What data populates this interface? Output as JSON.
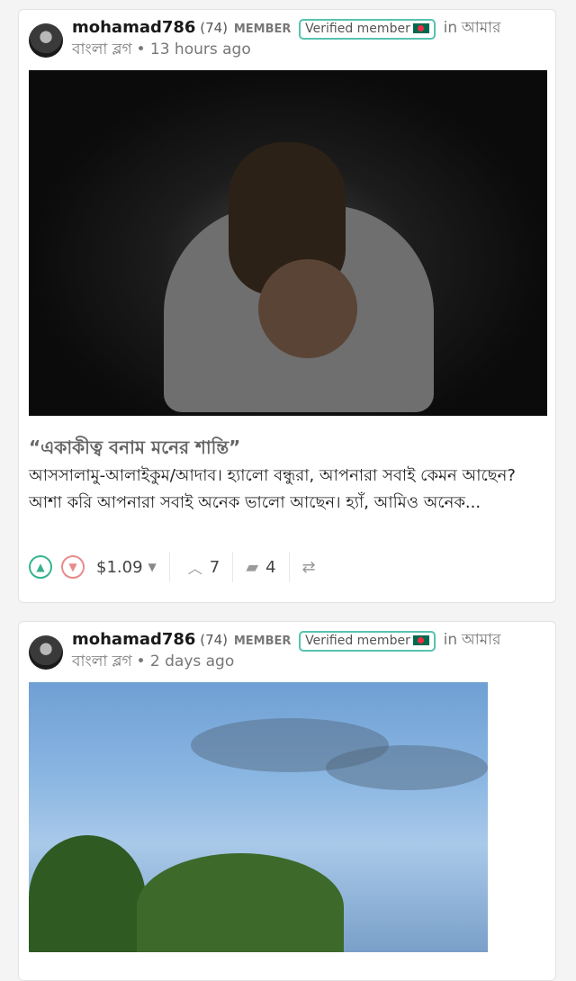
{
  "posts": [
    {
      "author": "mohamad786",
      "reputation": "(74)",
      "role": "MEMBER",
      "badge": "Verified member",
      "in_word": "in",
      "community": "আমার বাংলা ব্লগ",
      "time": "13 hours ago",
      "title": "“একাকীত্ব বনাম মনের শান্তি”",
      "excerpt": "আসসালামু-আলাইকুম/আদাব। হ্যালো বন্ধুরা, আপনারা সবাই কেমন আছেন? আশা করি আপনারা সবাই অনেক ভালো আছেন। হ্যাঁ, আমিও অনেক...",
      "payout": "$1.09",
      "votes": "7",
      "comments": "4"
    },
    {
      "author": "mohamad786",
      "reputation": "(74)",
      "role": "MEMBER",
      "badge": "Verified member",
      "in_word": "in",
      "community": "আমার বাংলা ব্লগ",
      "time": "2 days ago"
    }
  ],
  "icons": {
    "upvote": "chevron-up-circle-icon",
    "downvote": "chevron-down-circle-icon",
    "payout_caret": "caret-down-icon",
    "votes": "chevron-up-icon",
    "comments": "comments-icon",
    "reblog": "reblog-icon",
    "flag": "bangladesh-flag-icon"
  },
  "colors": {
    "badge_border": "#57c2b1",
    "upvote": "#35b38f",
    "downvote": "#e98a8a"
  }
}
